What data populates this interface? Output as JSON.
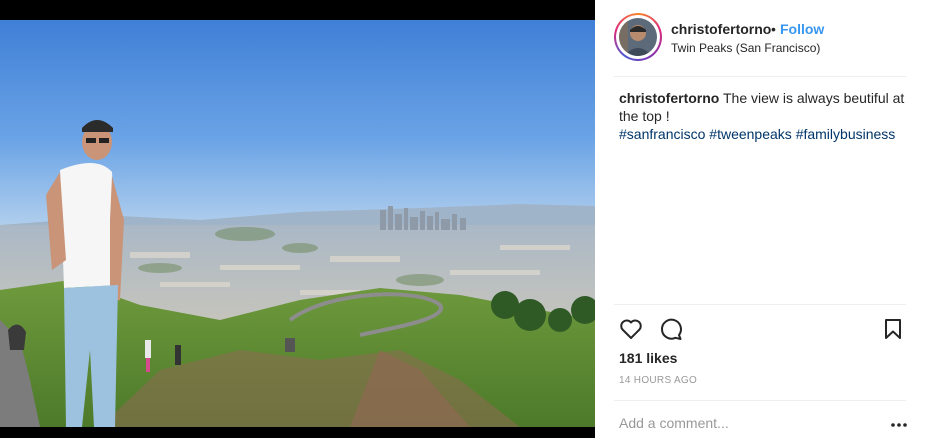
{
  "post": {
    "username": "christofertorno",
    "separator": "•",
    "follow_label": "Follow",
    "location": "Twin Peaks (San Francisco)",
    "caption": {
      "username": "christofertorno",
      "text": "The view is always beutiful at the top !",
      "hashtags": [
        "#sanfrancisco",
        "#tweenpeaks",
        "#familybusiness"
      ]
    },
    "likes": "181 likes",
    "time_ago": "14 HOURS AGO",
    "comment_placeholder": "Add a comment..."
  },
  "icons": {
    "like": "heart-outline-icon",
    "comment": "speech-bubble-icon",
    "save": "bookmark-icon",
    "more": "ellipsis-icon"
  },
  "colors": {
    "follow": "#3897f0",
    "hashtag": "#003569",
    "muted": "#999999",
    "text": "#262626",
    "divider": "#efefef"
  }
}
